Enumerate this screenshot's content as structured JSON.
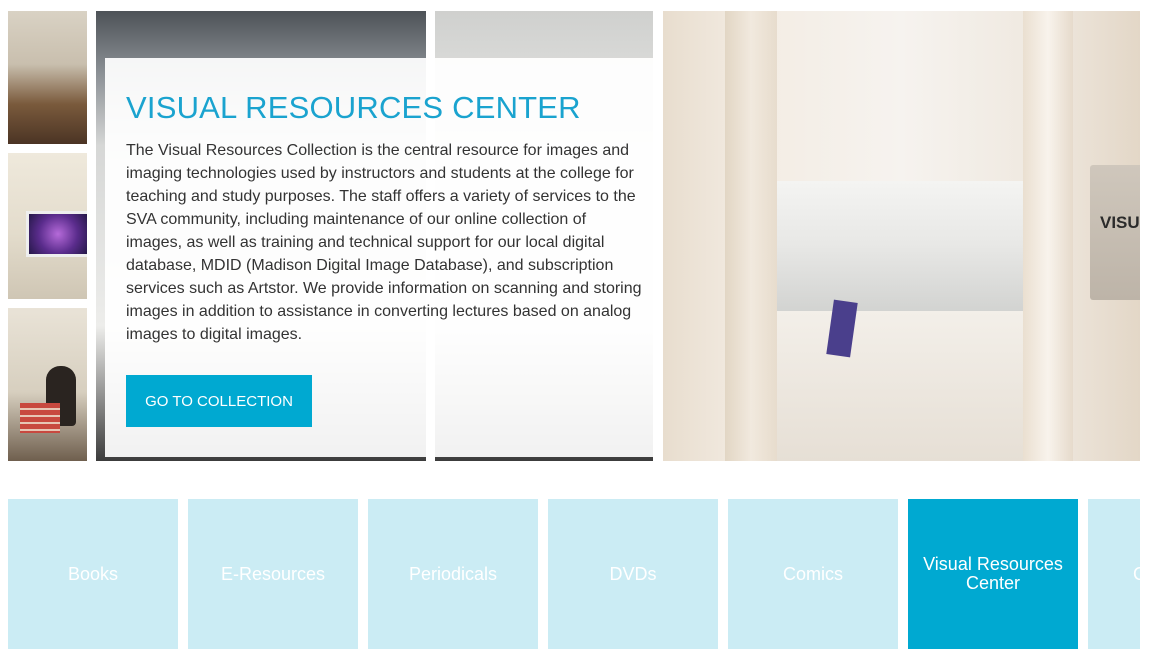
{
  "hero": {
    "title": "VISUAL RESOURCES CENTER",
    "description": "The Visual Resources Collection is the central resource for images and imaging technologies used by instructors and students at the college for teaching and study purposes. The staff offers a variety of services to the SVA community, including maintenance of our online collection of images, as well as training and technical support for our local digital database, MDID (Madison Digital Image Database), and subscription services such as Artstor. We provide information on scanning and storing images in addition to assistance in converting lectures based on analog images to digital images.",
    "button_label": "GO TO COLLECTION",
    "sign_text": "VISUAL RESOURCES CENTER"
  },
  "categories": [
    {
      "label": "Books",
      "active": false
    },
    {
      "label": "E-Resources",
      "active": false
    },
    {
      "label": "Periodicals",
      "active": false
    },
    {
      "label": "DVDs",
      "active": false
    },
    {
      "label": "Comics",
      "active": false
    },
    {
      "label": "Visual Resources Center",
      "active": true
    },
    {
      "label": "G",
      "active": false
    }
  ],
  "colors": {
    "accent": "#00a9d1",
    "title": "#1aa3cf",
    "tile": "#cbecf4"
  }
}
